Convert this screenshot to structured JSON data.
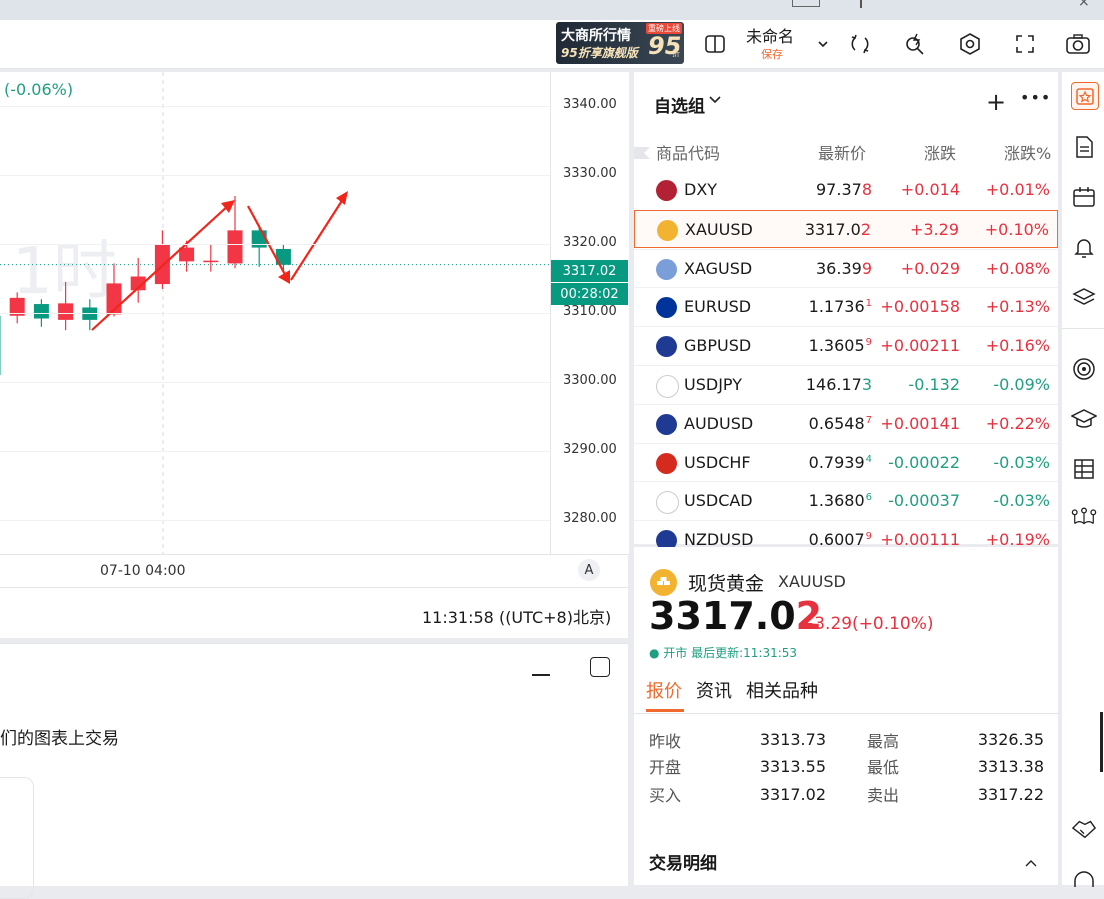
{
  "toolbar": {
    "ad_line1": "大商所行情",
    "ad_line2": "95折享旗舰版",
    "ad_badge": "重磅上线",
    "ad_big": "95",
    "ad_zhe": "折",
    "layout_name": "未命名",
    "save_label": "保存"
  },
  "chart": {
    "change_text": "(-0.06%)",
    "watermark": "1时",
    "y_ticks": [
      "3340.00",
      "3330.00",
      "3320.00",
      "3310.00",
      "3300.00",
      "3290.00",
      "3280.00"
    ],
    "price_tag": "3317.02",
    "countdown_tag": "00:28:02",
    "time_label": "07-10 04:00",
    "auto_label": "A"
  },
  "chart_data": {
    "type": "candlestick",
    "ylim": [
      3275,
      3345
    ],
    "y_ticks": [
      3340,
      3330,
      3320,
      3310,
      3300,
      3290,
      3280
    ],
    "candles": [
      {
        "open": 3309.6,
        "close": 3301.0,
        "high": 3312.0,
        "low": 3299.0
      },
      {
        "open": 3309.6,
        "close": 3312.2,
        "high": 3313.0,
        "low": 3308.5
      },
      {
        "open": 3311.3,
        "close": 3309.2,
        "high": 3312.0,
        "low": 3308.0
      },
      {
        "open": 3309.0,
        "close": 3311.4,
        "high": 3314.5,
        "low": 3307.5
      },
      {
        "open": 3310.8,
        "close": 3309.0,
        "high": 3312.0,
        "low": 3307.5
      },
      {
        "open": 3309.8,
        "close": 3314.3,
        "high": 3317.2,
        "low": 3309.5
      },
      {
        "open": 3313.3,
        "close": 3315.3,
        "high": 3318.0,
        "low": 3311.5
      },
      {
        "open": 3314.2,
        "close": 3320.0,
        "high": 3322.0,
        "low": 3313.5
      },
      {
        "open": 3317.5,
        "close": 3319.5,
        "high": 3320.5,
        "low": 3316.0
      },
      {
        "open": 3317.6,
        "close": 3317.6,
        "high": 3320.0,
        "low": 3316.0
      },
      {
        "open": 3317.2,
        "close": 3322.0,
        "high": 3327.0,
        "low": 3316.5
      },
      {
        "open": 3322.0,
        "close": 3319.5,
        "high": 3322.8,
        "low": 3316.7
      },
      {
        "open": 3319.3,
        "close": 3317.0,
        "high": 3320.0,
        "low": 3316.0
      }
    ],
    "current_price": 3317.02,
    "time_tick": "07-10 04:00",
    "colors": {
      "up": "#f23645",
      "down": "#089981"
    }
  },
  "status": {
    "clock": "11:31:58 ((UTC+8)北京)"
  },
  "bottom_panel": {
    "text": "们的图表上交易"
  },
  "watchlist": {
    "title": "自选组",
    "headers": [
      "商品代码",
      "最新价",
      "涨跌",
      "涨跌%"
    ],
    "rows": [
      {
        "symbol": "DXY",
        "price_main": "97.37",
        "price_last": "8",
        "change": "+0.014",
        "pct": "+0.01%",
        "dir": "up",
        "flag": "us"
      },
      {
        "symbol": "XAUUSD",
        "price_main": "3317.0",
        "price_last": "2",
        "change": "+3.29",
        "pct": "+0.10%",
        "dir": "up",
        "flag": "gold"
      },
      {
        "symbol": "XAGUSD",
        "price_main": "36.39",
        "price_last": "9",
        "change": "+0.029",
        "pct": "+0.08%",
        "dir": "up",
        "flag": "silver"
      },
      {
        "symbol": "EURUSD",
        "price_main": "1.1736",
        "price_last": "",
        "sup": "1",
        "change": "+0.00158",
        "pct": "+0.13%",
        "dir": "up",
        "flag": "eu"
      },
      {
        "symbol": "GBPUSD",
        "price_main": "1.3605",
        "price_last": "",
        "sup": "9",
        "change": "+0.00211",
        "pct": "+0.16%",
        "dir": "up",
        "flag": "gb"
      },
      {
        "symbol": "USDJPY",
        "price_main": "146.17",
        "price_last": "3",
        "change": "-0.132",
        "pct": "-0.09%",
        "dir": "down",
        "flag": "jp"
      },
      {
        "symbol": "AUDUSD",
        "price_main": "0.6548",
        "price_last": "",
        "sup": "7",
        "change": "+0.00141",
        "pct": "+0.22%",
        "dir": "up",
        "flag": "au"
      },
      {
        "symbol": "USDCHF",
        "price_main": "0.7939",
        "price_last": "",
        "sup": "4",
        "change": "-0.00022",
        "pct": "-0.03%",
        "dir": "down",
        "flag": "ch"
      },
      {
        "symbol": "USDCAD",
        "price_main": "1.3680",
        "price_last": "",
        "sup": "6",
        "change": "-0.00037",
        "pct": "-0.03%",
        "dir": "down",
        "flag": "ca"
      },
      {
        "symbol": "NZDUSD",
        "price_main": "0.6007",
        "price_last": "",
        "sup": "9",
        "change": "+0.00111",
        "pct": "+0.19%",
        "dir": "up",
        "flag": "nz"
      }
    ]
  },
  "detail": {
    "name": "现货黄金",
    "symbol": "XAUUSD",
    "price_main": "3317.0",
    "price_last": "2",
    "change": "+3.29",
    "pct": "(+0.10%)",
    "market_status": "● 开市 最后更新:11:31:53",
    "tabs": [
      "报价",
      "资讯",
      "相关品种"
    ],
    "stats": [
      {
        "label": "昨收",
        "value": "3313.73",
        "label2": "最高",
        "value2": "3326.35"
      },
      {
        "label": "开盘",
        "value": "3313.55",
        "label2": "最低",
        "value2": "3313.38"
      },
      {
        "label": "买入",
        "value": "3317.02",
        "label2": "卖出",
        "value2": "3317.22"
      }
    ],
    "trades_title": "交易明细"
  }
}
